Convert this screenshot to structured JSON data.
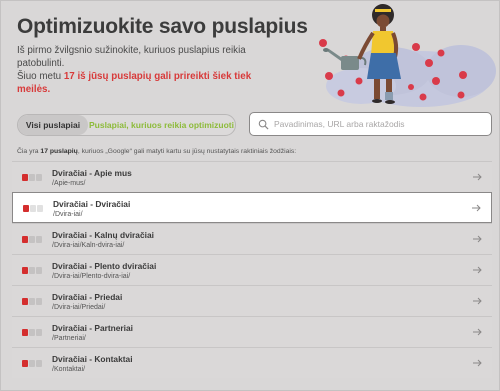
{
  "header": {
    "title": "Optimizuokite savo puslapius",
    "intro_line1": "Iš pirmo žvilgsnio sužinokite, kuriuos puslapius reikia patobulinti.",
    "intro_line2_prefix": "Šiuo metu ",
    "intro_line2_strong": "17 iš jūsų puslapių gali prireikti šiek tiek meilės."
  },
  "tabs": {
    "all_label": "Visi puslapiai",
    "optimize_label": "Puslapiai, kuriuos reikia optimizuoti"
  },
  "search": {
    "placeholder": "Pavadinimas, URL arba raktažodis"
  },
  "count": {
    "prefix": "Čia yra ",
    "strong": "17 puslapių",
    "suffix": ", kuriuos „Google“ gali matyti kartu su jūsų nustatytais raktiniais žodžiais:"
  },
  "pages": [
    {
      "title": "Dviračiai - Apie mus",
      "url": "/Apie-mus/"
    },
    {
      "title": "Dviračiai - Dviračiai",
      "url": "/Dvira-iai/"
    },
    {
      "title": "Dviračiai - Kalnų dviračiai",
      "url": "/Dvira-iai/Kaln-dvira-iai/"
    },
    {
      "title": "Dviračiai - Plento dviračiai",
      "url": "/Dvira-iai/Plento-dvira-iai/"
    },
    {
      "title": "Dviračiai - Priedai",
      "url": "/Dvira-iai/Priedai/"
    },
    {
      "title": "Dviračiai - Partneriai",
      "url": "/Partneriai/"
    },
    {
      "title": "Dviračiai - Kontaktai",
      "url": "/Kontaktai/"
    }
  ],
  "colors": {
    "accent_red": "#d83a3a",
    "accent_green": "#8dbb3a"
  }
}
